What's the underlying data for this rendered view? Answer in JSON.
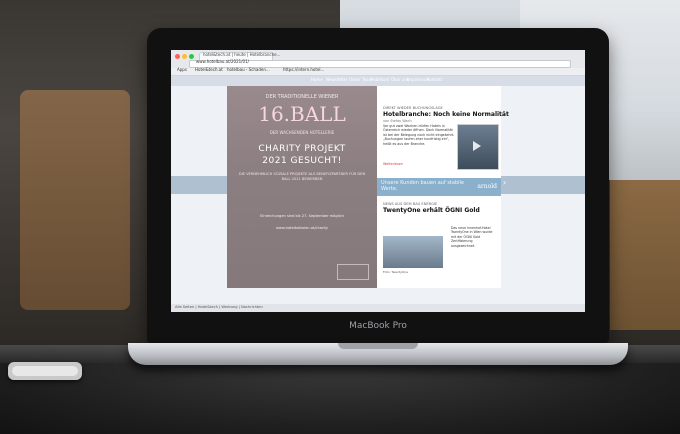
{
  "browser": {
    "tab_title": "hotel&tech.at | heute | Hotelbranche...",
    "url": "www.hotelbau.at/2021/01/",
    "bookmarks": [
      "Apps",
      "Hotel&tech.at",
      "hotelbau - Schaden...",
      "https://intern.hotel..."
    ]
  },
  "site": {
    "nav_items": [
      "Home",
      "Newsletter",
      "Unser Team",
      "Publikum",
      "Über uns",
      "Impressum",
      "Kontakt"
    ]
  },
  "ad_left": {
    "top_line": "DER TRADITIONELLE WIENER",
    "number": "16.BALL",
    "subline": "DER WACHSENDEN HOTELLERIE",
    "headline_1": "CHARITY PROJEKT",
    "headline_2": "2021 GESUCHT!",
    "desc": "DIE VERNEHMLICH SOZIALE PROJEKTE ALS BENEFIZPARTNER FÜR DEN BALL 2021 BEWERBEN",
    "deadline": "Einreichungen sind bis 27. September möglich",
    "url": "www.hotelballwien.at/charity"
  },
  "article": {
    "kicker": "DIREKT WIEDER BUCHUNGSLAGE",
    "title": "Hotelbranche: Noch keine Normalität",
    "author": "von Stefan Wach",
    "body": "Vor gut zwei Wochen dürfen Hotels in Österreich wieder öffnen. Doch Normalität ist bei der Belegung noch nicht eingekehrt. „Buchungen laufen eher kurzfristig ein“, heißt es aus der Branche.",
    "more": "Weiterlesen"
  },
  "strip_ad": {
    "text": "Unsere Kunden bauen auf stabile Werte.",
    "brand": "arnold"
  },
  "second_article": {
    "kicker": "NEWS AUS DEM BAU ENERGIE",
    "title": "TwentyOne erhält ÖGNI Gold",
    "caption": "Foto: TwentyOne",
    "body": "Das neue Innenhof-Hotel TwentyOne in Wien wurde mit der ÖGNI Gold Zertifizierung ausgezeichnet."
  },
  "laptop": {
    "brand_label": "MacBook Pro"
  },
  "status": {
    "text": "Alle Seiten | Hotel&tech | Werbung | Nachrichten"
  }
}
